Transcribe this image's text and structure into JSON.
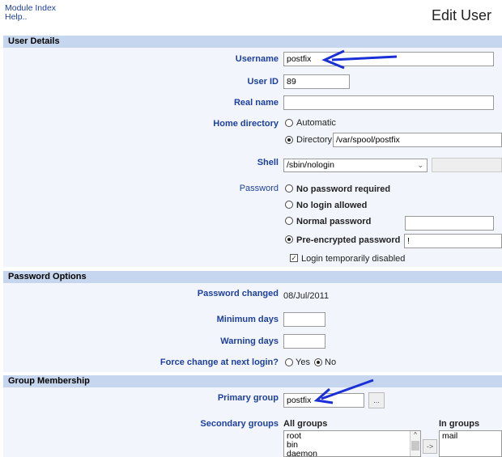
{
  "header": {
    "module_index": "Module Index",
    "help": "Help..",
    "title": "Edit User"
  },
  "user_details": {
    "section_title": "User Details",
    "username_label": "Username",
    "username_value": "postfix",
    "userid_label": "User ID",
    "userid_value": "89",
    "realname_label": "Real name",
    "realname_value": "",
    "home_label": "Home directory",
    "home_automatic": "Automatic",
    "home_directory": "Directory",
    "home_value": "/var/spool/postfix",
    "shell_label": "Shell",
    "shell_value": "/sbin/nologin",
    "password_label": "Password",
    "pw_none": "No password required",
    "pw_nologin": "No login allowed",
    "pw_normal": "Normal password",
    "pw_preencrypted": "Pre-encrypted password",
    "pw_preencrypted_value": "!",
    "login_disabled": "Login temporarily disabled"
  },
  "password_options": {
    "section_title": "Password Options",
    "changed_label": "Password changed",
    "changed_value": "08/Jul/2011",
    "min_days_label": "Minimum days",
    "warning_days_label": "Warning days",
    "force_label": "Force change at next login?",
    "yes": "Yes",
    "no": "No"
  },
  "group_membership": {
    "section_title": "Group Membership",
    "primary_label": "Primary group",
    "primary_value": "postfix",
    "browse_label": "...",
    "secondary_label": "Secondary groups",
    "all_groups_label": "All groups",
    "in_groups_label": "In groups",
    "all_groups": [
      "root",
      "bin",
      "daemon"
    ],
    "in_groups": [
      "mail"
    ],
    "move_button": "->"
  },
  "colors": {
    "section_header": "#c7d6ef",
    "section_body": "#f2f6fc",
    "label": "#1d3f9e",
    "annotation_arrow": "#1a2fd6"
  }
}
